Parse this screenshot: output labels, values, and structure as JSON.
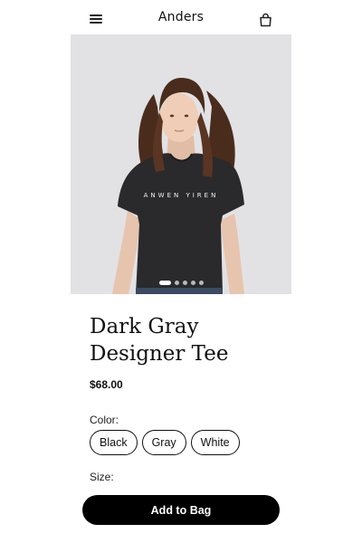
{
  "header": {
    "brand": "Anders",
    "menu_icon": "hamburger-menu-icon",
    "bag_icon": "shopping-bag-icon"
  },
  "product": {
    "image_alt": "Woman wearing dark gray designer tee",
    "shirt_print": "ANWEN YIREN",
    "carousel": {
      "count": 5,
      "active_index": 0
    },
    "title": "Dark Gray Designer Tee",
    "price": "$68.00",
    "color_label": "Color:",
    "colors": [
      "Black",
      "Gray",
      "White"
    ],
    "size_label": "Size:"
  },
  "cta": {
    "add_to_bag": "Add to Bag"
  }
}
